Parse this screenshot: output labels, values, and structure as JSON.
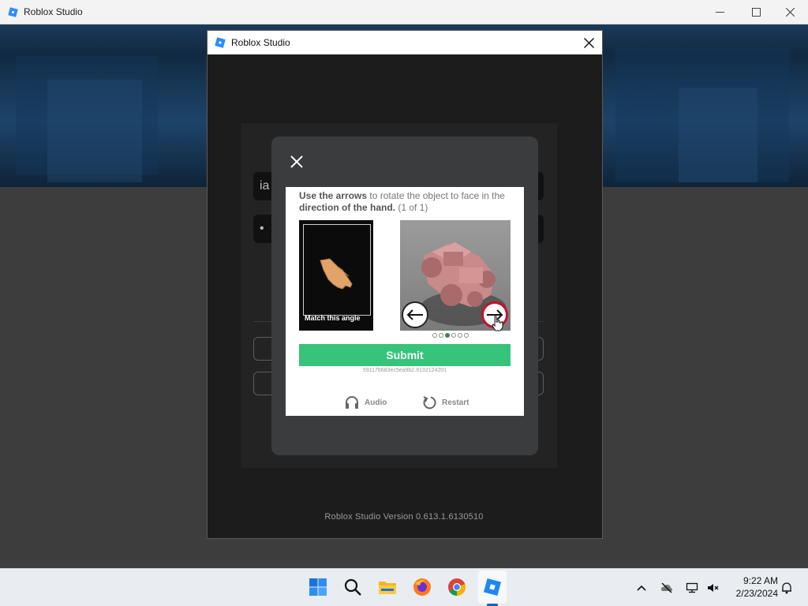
{
  "outer_window": {
    "title": "Roblox Studio",
    "controls": [
      "minimize-icon",
      "maximize-icon",
      "close-icon"
    ]
  },
  "studio_window": {
    "title": "Roblox Studio",
    "login_field_1_partial": "ia",
    "login_field_2_partial": "•"
  },
  "version_text": "Roblox Studio Version 0.613.1.6130510",
  "captcha": {
    "instruction_parts": [
      "Use the arrows",
      " to rotate the object",
      " to face in the ",
      "direction of the hand.",
      " (1 of 1)"
    ],
    "hand_caption": "Match this angle",
    "progress": {
      "total": 6,
      "active_index": 2
    },
    "submit_label": "Submit",
    "session_id": "59117b683ec5ea9b2.9132124201",
    "audio_label": "Audio",
    "restart_label": "Restart"
  },
  "taskbar": {
    "apps": [
      "windows-start-icon",
      "search-icon",
      "file-explorer-icon",
      "firefox-icon",
      "chrome-icon",
      "roblox-studio-icon"
    ],
    "active_app": "roblox-studio-icon",
    "time": "9:22 AM",
    "date": "2/23/2024"
  },
  "colors": {
    "submit_green": "#36c37a",
    "accent_red": "#c8102e",
    "taskbar_bg": "#e9edf1"
  }
}
